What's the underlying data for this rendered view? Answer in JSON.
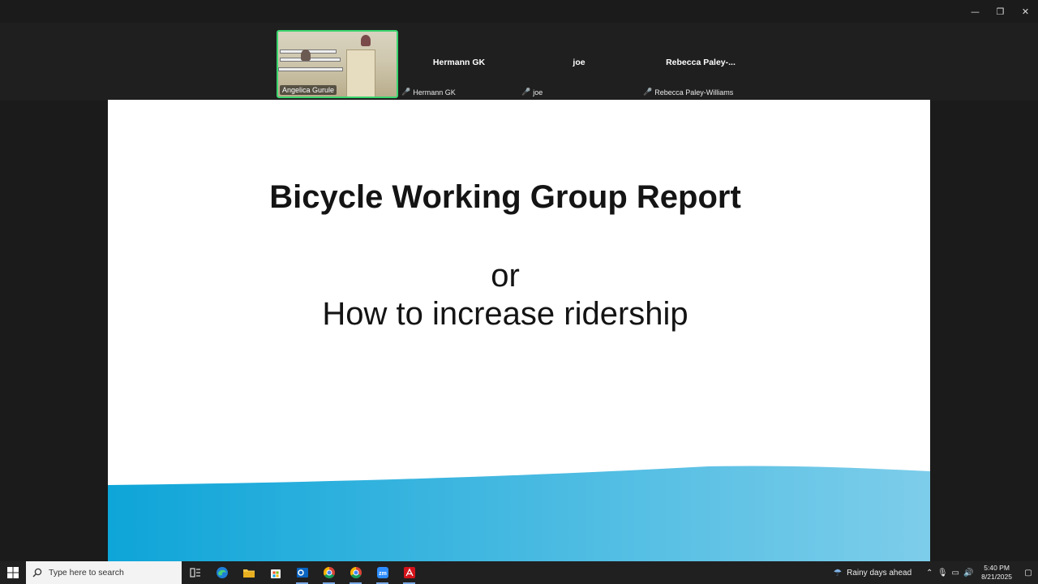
{
  "window": {
    "minimize": "—",
    "restore": "❐",
    "close": "✕"
  },
  "participants": [
    {
      "name": "Angelica Gurule",
      "video": true
    },
    {
      "name": "Hermann GK",
      "display": "Hermann GK",
      "muted": true
    },
    {
      "name": "joe",
      "display": "joe",
      "muted": true
    },
    {
      "name": "Rebecca Paley-Williams",
      "display": "Rebecca Paley-...",
      "muted": true
    }
  ],
  "slide": {
    "title": "Bicycle Working Group Report",
    "connector": "or",
    "subtitle": "How to increase ridership",
    "wave_colors": [
      "#0ea5d8",
      "#7dcdea"
    ]
  },
  "taskbar": {
    "search_placeholder": "Type here to search",
    "apps": [
      "task-view-icon",
      "edge-icon",
      "file-explorer-icon",
      "store-icon",
      "outlook-icon",
      "chrome-icon",
      "chrome-icon",
      "zoom-icon",
      "acrobat-icon"
    ],
    "weather": "Rainy days ahead",
    "time": "5:40 PM",
    "date": "8/21/2025"
  }
}
